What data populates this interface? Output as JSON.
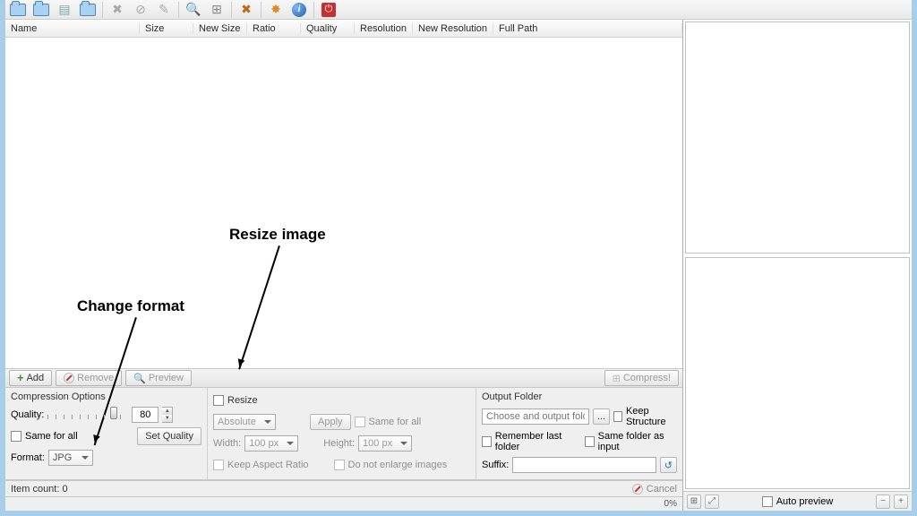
{
  "columns": {
    "name": "Name",
    "size": "Size",
    "newsize": "New Size",
    "ratio": "Ratio",
    "quality": "Quality",
    "resolution": "Resolution",
    "newresolution": "New Resolution",
    "fullpath": "Full Path"
  },
  "annotations": {
    "resize": "Resize image",
    "format": "Change format"
  },
  "midbar": {
    "add": "Add",
    "remove": "Remove",
    "preview": "Preview",
    "compress": "Compress!"
  },
  "compression": {
    "title": "Compression Options",
    "quality_label": "Quality:",
    "quality_value": "80",
    "same_for_all": "Same for all",
    "set_quality": "Set Quality",
    "format_label": "Format:",
    "format_value": "JPG"
  },
  "resize": {
    "title": "Resize",
    "mode": "Absolute",
    "apply": "Apply",
    "same_for_all": "Same for all",
    "width_label": "Width:",
    "width_value": "100 px",
    "height_label": "Height:",
    "height_value": "100 px",
    "keep_aspect": "Keep Aspect Ratio",
    "no_enlarge": "Do not enlarge images"
  },
  "output": {
    "title": "Output Folder",
    "placeholder": "Choose and output folder...",
    "browse": "...",
    "keep_structure": "Keep Structure",
    "remember": "Remember last folder",
    "same_as_input": "Same folder as input",
    "suffix_label": "Suffix:"
  },
  "status": {
    "item_count": "Item count: 0",
    "cancel": "Cancel",
    "progress": "0%"
  },
  "preview_footer": {
    "auto_preview": "Auto preview"
  }
}
